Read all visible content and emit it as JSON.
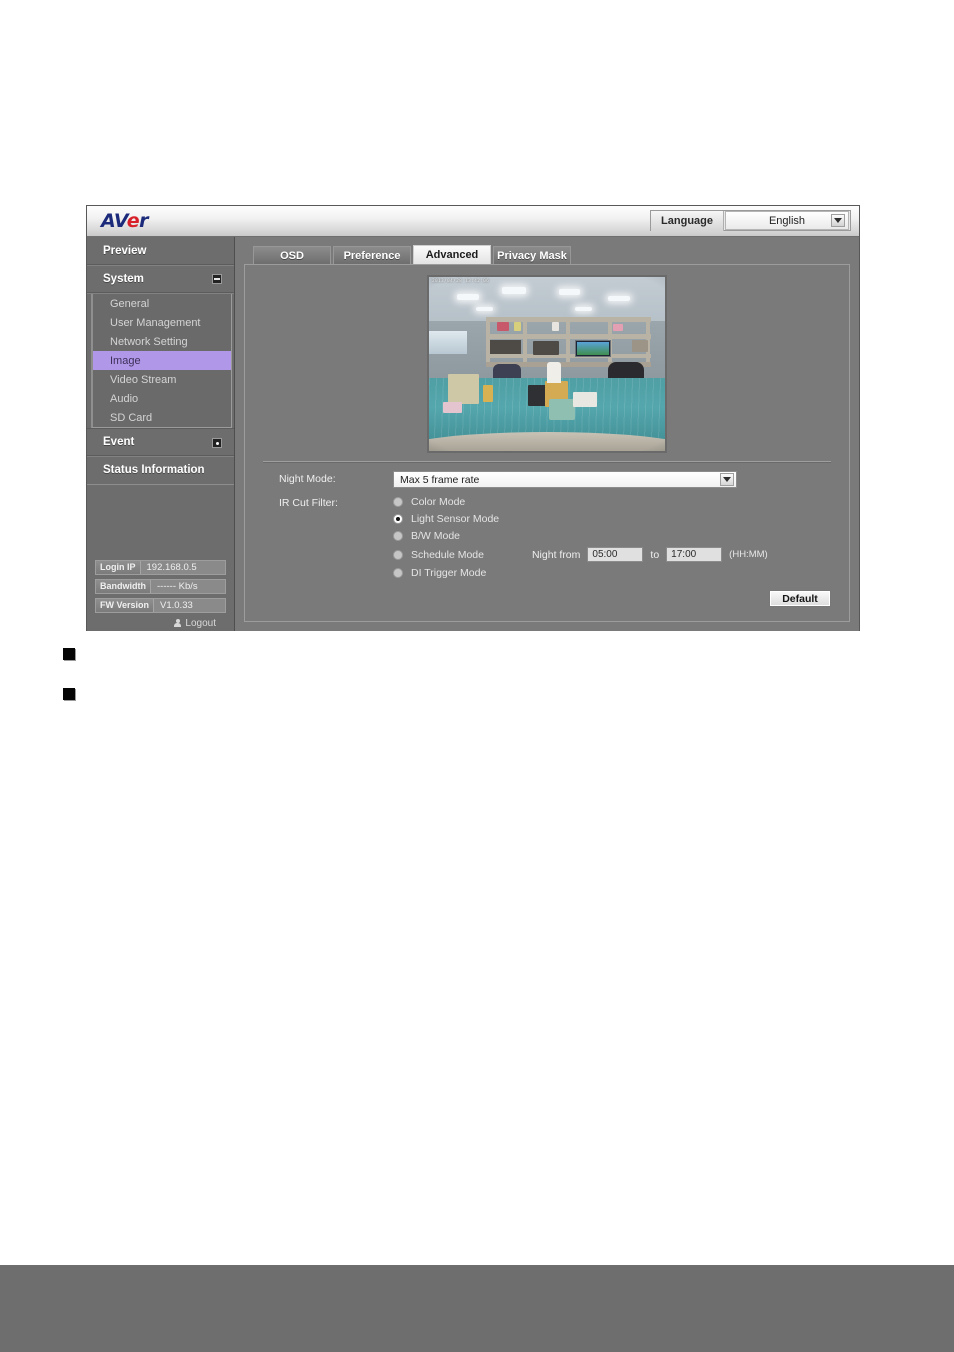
{
  "header": {
    "logo_a": "AV",
    "logo_e": "e",
    "logo_r": "r",
    "language_label": "Language",
    "language_value": "English"
  },
  "sidebar": {
    "preview_label": "Preview",
    "system_label": "System",
    "system_toggle_icon": "minus-box-icon",
    "submenu": [
      {
        "label": "General"
      },
      {
        "label": "User Management"
      },
      {
        "label": "Network Setting"
      },
      {
        "label": "Image"
      },
      {
        "label": "Video Stream"
      },
      {
        "label": "Audio"
      },
      {
        "label": "SD Card"
      }
    ],
    "active_submenu": "Image",
    "event_label": "Event",
    "event_toggle_icon": "plus-dot-box-icon",
    "status_information_label": "Status Information",
    "info": [
      {
        "key": "Login IP",
        "value": "192.168.0.5"
      },
      {
        "key": "Bandwidth",
        "value": "------ Kb/s"
      },
      {
        "key": "FW Version",
        "value": "V1.0.33"
      }
    ],
    "logout_label": "Logout",
    "logout_icon": "person-icon"
  },
  "tabs": [
    {
      "label": "OSD",
      "active": false
    },
    {
      "label": "Preference",
      "active": false
    },
    {
      "label": "Advanced",
      "active": true
    },
    {
      "label": "Privacy Mask",
      "active": false
    }
  ],
  "video": {
    "osd_overlay": "2013/04/28 13:42:06",
    "alt": "live camera preview of an office room with shelving, desks, chairs and a monitor"
  },
  "form": {
    "night_mode_label": "Night Mode:",
    "night_mode_value": "Max 5 frame rate",
    "ir_cut_filter_label": "IR Cut Filter:",
    "ir_options": [
      {
        "label": "Color Mode",
        "checked": false
      },
      {
        "label": "Light Sensor Mode",
        "checked": true
      },
      {
        "label": "B/W Mode",
        "checked": false
      },
      {
        "label": "Schedule Mode",
        "checked": false
      },
      {
        "label": "DI Trigger Mode",
        "checked": false
      }
    ],
    "schedule": {
      "night_from_label": "Night from",
      "from_value": "05:00",
      "to_label": "to",
      "to_value": "17:00",
      "format_hint": "(HH:MM)"
    },
    "default_button": "Default"
  },
  "colors": {
    "accent_active_menu": "#b197e8",
    "panel_bg": "#7a7a7a",
    "sidebar_bg": "#6d6d6d",
    "logo_blue": "#1b2a7a",
    "logo_red": "#d8202a",
    "footer_band": "#6e6e6e"
  },
  "bullets": [
    {
      "marker": "square-bullet"
    },
    {
      "marker": "square-bullet"
    }
  ]
}
